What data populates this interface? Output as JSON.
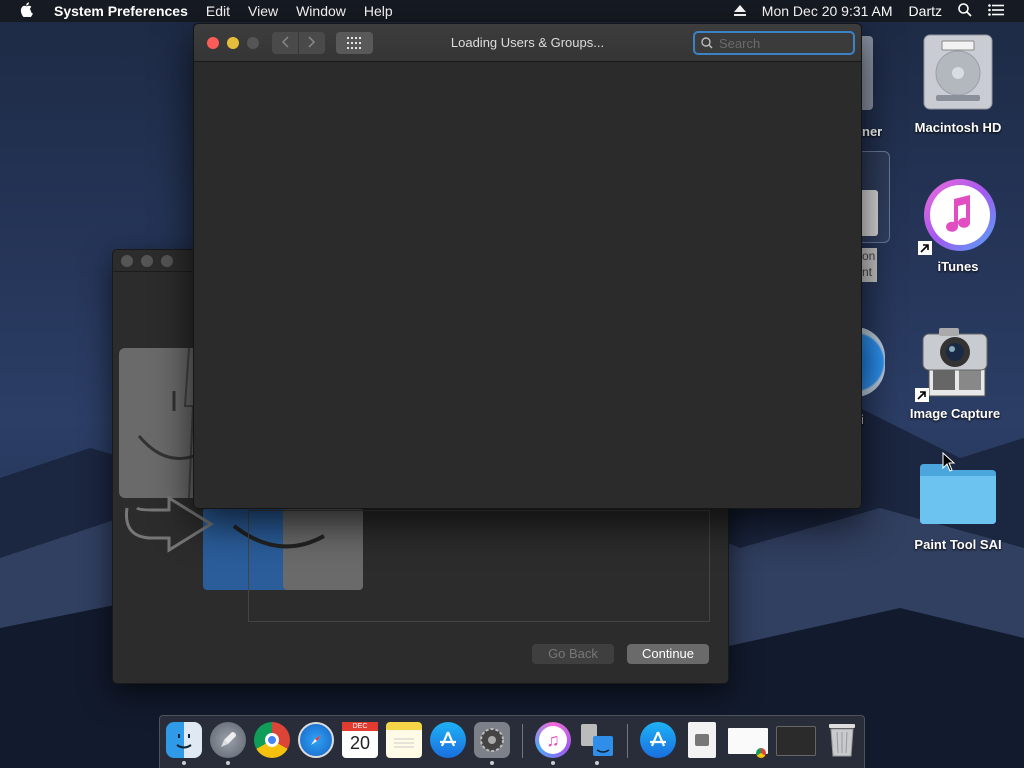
{
  "menubar": {
    "app_name": "System Preferences",
    "menus": [
      "Edit",
      "View",
      "Window",
      "Help"
    ],
    "clock": "Mon Dec 20  9:31 AM",
    "user": "Dartz"
  },
  "desktop": {
    "icons": [
      {
        "label": "Macintosh HD"
      },
      {
        "label": "iTunes"
      },
      {
        "label": "Image Capture"
      },
      {
        "label": "Paint Tool SAI"
      }
    ],
    "partial_labels": [
      "ner",
      "on",
      "nt",
      "i"
    ]
  },
  "front_window": {
    "title": "Loading Users & Groups...",
    "search_placeholder": "Search"
  },
  "back_window": {
    "go_back_label": "Go Back",
    "continue_label": "Continue"
  },
  "dock": {
    "calendar_month": "DEC",
    "calendar_day": "20",
    "items": [
      "finder-icon",
      "launchpad-icon",
      "chrome-icon",
      "safari-icon",
      "calendar-icon",
      "notes-icon",
      "app-store-icon",
      "system-preferences-icon",
      "itunes-icon",
      "migration-assistant-icon",
      "downloads-folder-icon",
      "document-icon",
      "screenshot-icon",
      "window-preview-icon",
      "trash-icon"
    ]
  },
  "colors": {
    "close": "#fc5b57",
    "minimize": "#e5bf3c",
    "search_focus": "#3c82c6",
    "folder": "#5bb8e8"
  }
}
